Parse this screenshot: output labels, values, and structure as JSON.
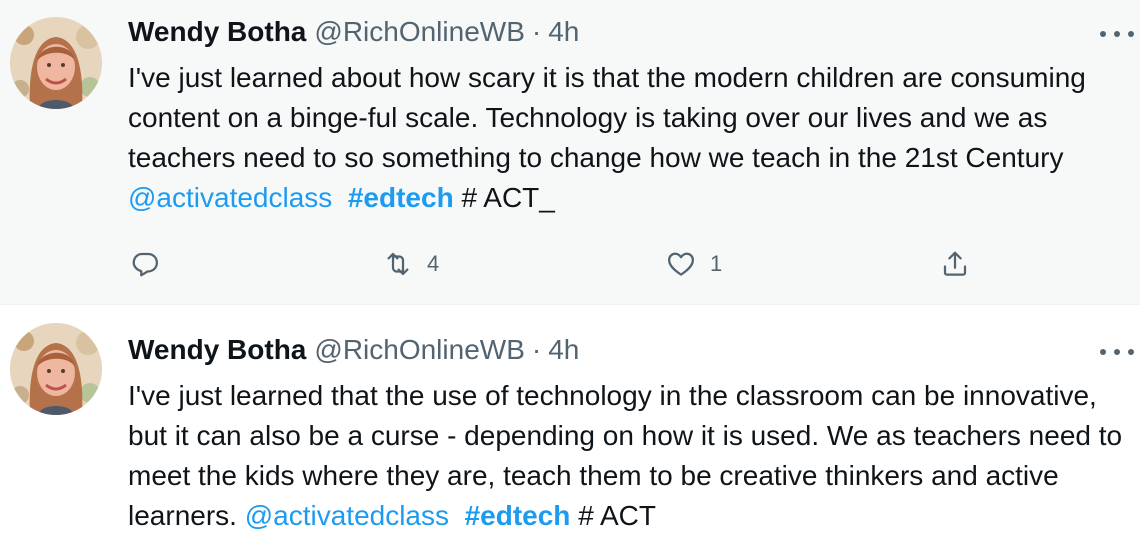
{
  "tweets": [
    {
      "author_name": "Wendy Botha",
      "handle": "@RichOnlineWB",
      "separator": "·",
      "time": "4h",
      "text_plain": "I've just learned about how scary it is that the modern children are consuming content on a binge-ful scale. Technology is taking over our lives and we as teachers need to so something to change how we teach in the 21st Century",
      "mention": "@activatedclass",
      "hashtag": "#edtech",
      "suffix": "# ACT_",
      "reply_count": "",
      "retweet_count": "4",
      "like_count": "1"
    },
    {
      "author_name": "Wendy Botha",
      "handle": "@RichOnlineWB",
      "separator": "·",
      "time": "4h",
      "text_plain": "I've just learned that the use of technology in the classroom can be innovative, but it can also be a curse - depending on how it is used. We as teachers need to meet the kids where they are, teach them to be creative thinkers and active learners.",
      "mention": "@activatedclass",
      "hashtag": "#edtech",
      "suffix": "# ACT"
    }
  ],
  "icons": {
    "reply": "reply-icon",
    "retweet": "retweet-icon",
    "like": "heart-icon",
    "share": "share-icon",
    "more": "more-icon"
  },
  "colors": {
    "link": "#1d9bf0",
    "secondary_text": "#536471",
    "hover_background": "#f7f9f9"
  }
}
